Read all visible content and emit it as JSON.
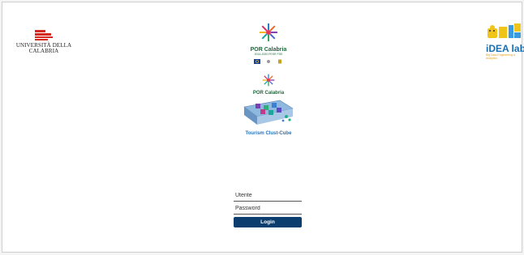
{
  "logos": {
    "unical_name": "UNIVERSITÀ DELLA\nCALABRIA",
    "por_title": "POR Calabria",
    "por_subtitle": "2014-2020 FESR FSE",
    "idealab_title": "iDEA lab",
    "idealab_subtitle": "Big Data Engineering &\nAnalytics",
    "tourism_por": "POR Calabria",
    "tourism_caption": "Tourism Clust-Cube"
  },
  "login": {
    "username_placeholder": "Utente",
    "password_placeholder": "Password",
    "button_label": "Login"
  },
  "colors": {
    "unical_red": "#d42a20",
    "login_button": "#0b3d6e",
    "por_green": "#1d6a3b",
    "idealab_blue": "#1a6fb0"
  }
}
